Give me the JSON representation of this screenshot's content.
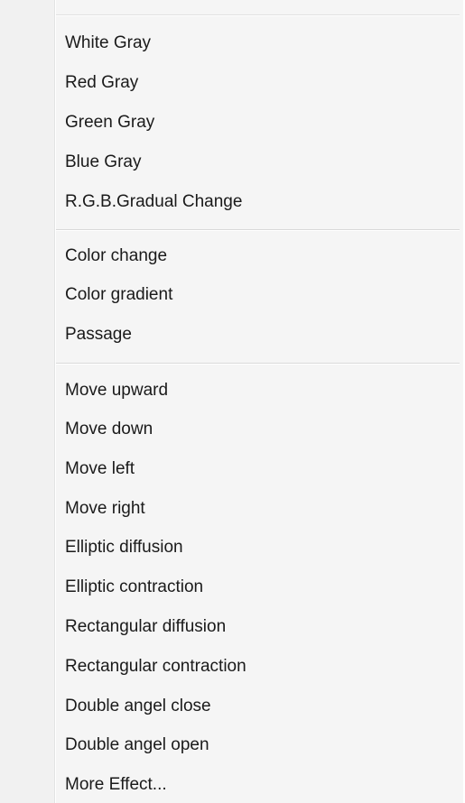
{
  "menu": {
    "groups": [
      {
        "items": [
          {
            "label": "White Gray"
          },
          {
            "label": "Red Gray"
          },
          {
            "label": "Green Gray"
          },
          {
            "label": "Blue Gray"
          },
          {
            "label": "R.G.B.Gradual Change"
          }
        ]
      },
      {
        "items": [
          {
            "label": "Color change"
          },
          {
            "label": "Color gradient"
          },
          {
            "label": "Passage"
          }
        ]
      },
      {
        "items": [
          {
            "label": "Move upward"
          },
          {
            "label": "Move down"
          },
          {
            "label": "Move left"
          },
          {
            "label": "Move right"
          },
          {
            "label": "Elliptic diffusion"
          },
          {
            "label": "Elliptic contraction"
          },
          {
            "label": "Rectangular diffusion"
          },
          {
            "label": "Rectangular contraction"
          },
          {
            "label": "Double angel close"
          },
          {
            "label": "Double angel open"
          },
          {
            "label": "More Effect..."
          }
        ]
      }
    ]
  }
}
